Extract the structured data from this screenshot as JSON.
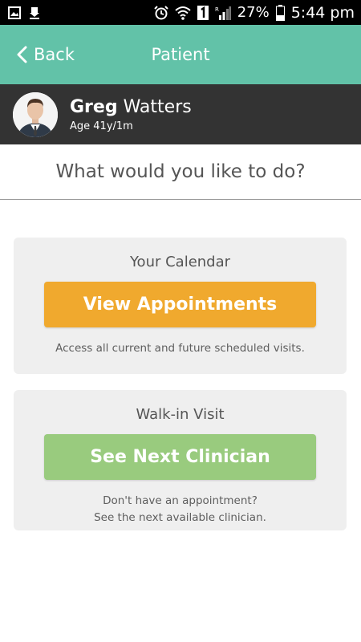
{
  "status_bar": {
    "battery": "27%",
    "time": "5:44 pm",
    "left_icons": [
      "image-icon",
      "download-icon"
    ],
    "right_icons": [
      "alarm-icon",
      "wifi-icon",
      "sim-icon",
      "signal-icon",
      "battery-icon"
    ]
  },
  "header": {
    "back_label": "Back",
    "title": "Patient",
    "bg_color": "#62c2a8"
  },
  "patient": {
    "first_name": "Greg",
    "last_name": "Watters",
    "age": "Age 41y/1m"
  },
  "prompt": "What would you like to do?",
  "cards": {
    "calendar": {
      "title": "Your Calendar",
      "button_label": "View Appointments",
      "button_color": "#f0a92e",
      "description": "Access all current and future scheduled visits."
    },
    "walkin": {
      "title": "Walk-in Visit",
      "button_label": "See Next Clinician",
      "button_color": "#99cb7e",
      "description_line1": "Don't have an appointment?",
      "description_line2": "See the next available clinician."
    }
  }
}
